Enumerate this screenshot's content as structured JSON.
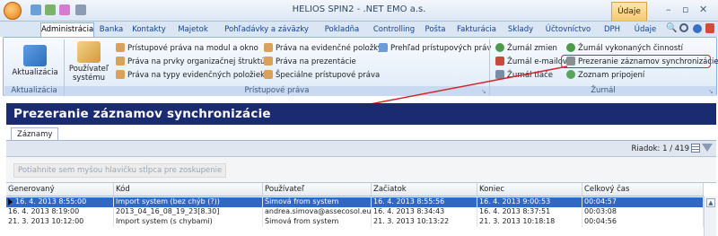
{
  "window": {
    "title": "HELIOS SPIN2 - .NET EMO a.s.",
    "context_tab": "Údaje",
    "quick_access": [
      "back",
      "forward",
      "save",
      "print"
    ]
  },
  "tabs": [
    {
      "label": "Administrácia",
      "active": true
    },
    {
      "label": "Banka"
    },
    {
      "label": "Kontakty"
    },
    {
      "label": "Majetok"
    },
    {
      "label": "Pohľadávky a záväzky"
    },
    {
      "label": "Pokladňa"
    },
    {
      "label": "Controlling"
    },
    {
      "label": "Pošta"
    },
    {
      "label": "Fakturácia"
    },
    {
      "label": "Sklady"
    },
    {
      "label": "Účtovníctvo"
    },
    {
      "label": "DPH"
    },
    {
      "label": "Údaje"
    }
  ],
  "ribbon": {
    "aktualizacia": {
      "button": "Aktualizácia",
      "group": "Aktualizácia"
    },
    "pristupove_prava": {
      "group": "Prístupové práva",
      "big_button": [
        "Používateľ",
        "systému"
      ],
      "items": [
        "Prístupové práva na modul a okno",
        "Práva na prvky organizačnej štruktúry",
        "Práva na typy evidenčných položiek",
        "Práva na evidenčné položky",
        "Práva na prezentácie",
        "Špeciálne prístupové práva",
        "Prehľad prístupových práv"
      ]
    },
    "zurnal": {
      "group": "Žurnál",
      "items": [
        "Žurnál zmien",
        "Žurnál e-mailov",
        "Žurnál tlače",
        "Žurnál vykonaných činností",
        "Prezeranie záznamov synchronizácie",
        "Zoznam pripojení"
      ]
    }
  },
  "form": {
    "title": "Prezeranie záznamov synchronizácie",
    "tab": "Záznamy",
    "row_counter": "Riadok: 1 / 419",
    "group_hint": "Potiahnite sem myšou hlavičku stĺpca pre zoskupenie",
    "columns": [
      "Generovaný",
      "Kód",
      "Používateľ",
      "Začiatok",
      "Koniec",
      "Celkový čas"
    ],
    "rows": [
      {
        "selected": true,
        "cells": [
          "16. 4. 2013 8:55:00",
          "Import system (bez chýb (?))",
          "Šimová from system",
          "16. 4. 2013 8:55:56",
          "16. 4. 2013 9:00:53",
          "00:04:57"
        ]
      },
      {
        "selected": false,
        "cells": [
          "16. 4. 2013 8:19:00",
          "2013_04_16_08_19_23[8.30]",
          "andrea.simova@assecosol.eu",
          "16. 4. 2013 8:34:43",
          "16. 4. 2013 8:37:51",
          "00:03:08"
        ]
      },
      {
        "selected": false,
        "cells": [
          "21. 3. 2013 10:12:00",
          "Import system (s chybami)",
          "Šimová from system",
          "21. 3. 2013 10:13:22",
          "21. 3. 2013 10:18:18",
          "00:04:56"
        ]
      }
    ]
  }
}
